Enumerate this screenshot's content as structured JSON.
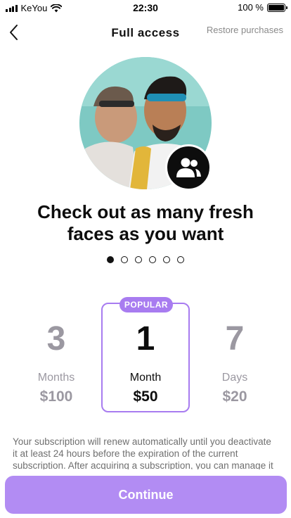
{
  "status_bar": {
    "carrier": "KeYou",
    "time": "22:30",
    "battery": "100 %"
  },
  "nav": {
    "title": "Full access",
    "restore_label": "Restore purchases"
  },
  "hero": {
    "badge_icon": "people-icon"
  },
  "headline": "Check out as many fresh faces as you want",
  "pager": {
    "count": 6,
    "active_index": 0
  },
  "plans": [
    {
      "number": "3",
      "unit": "Months",
      "price": "$100",
      "selected": false
    },
    {
      "number": "1",
      "unit": "Month",
      "price": "$50",
      "selected": true,
      "badge": "POPULAR"
    },
    {
      "number": "7",
      "unit": "Days",
      "price": "$20",
      "selected": false
    }
  ],
  "terms": "Your subscription will renew automatically until you deactivate it at least 24 hours before the expiration of the current subscription. After acquiring a subscription, you can manage it and turn off automatic renewal in the settings of your account.",
  "continue_label": "Continue",
  "colors": {
    "accent": "#a87cf0",
    "button": "#b28cf3",
    "muted": "#9b98a1"
  }
}
